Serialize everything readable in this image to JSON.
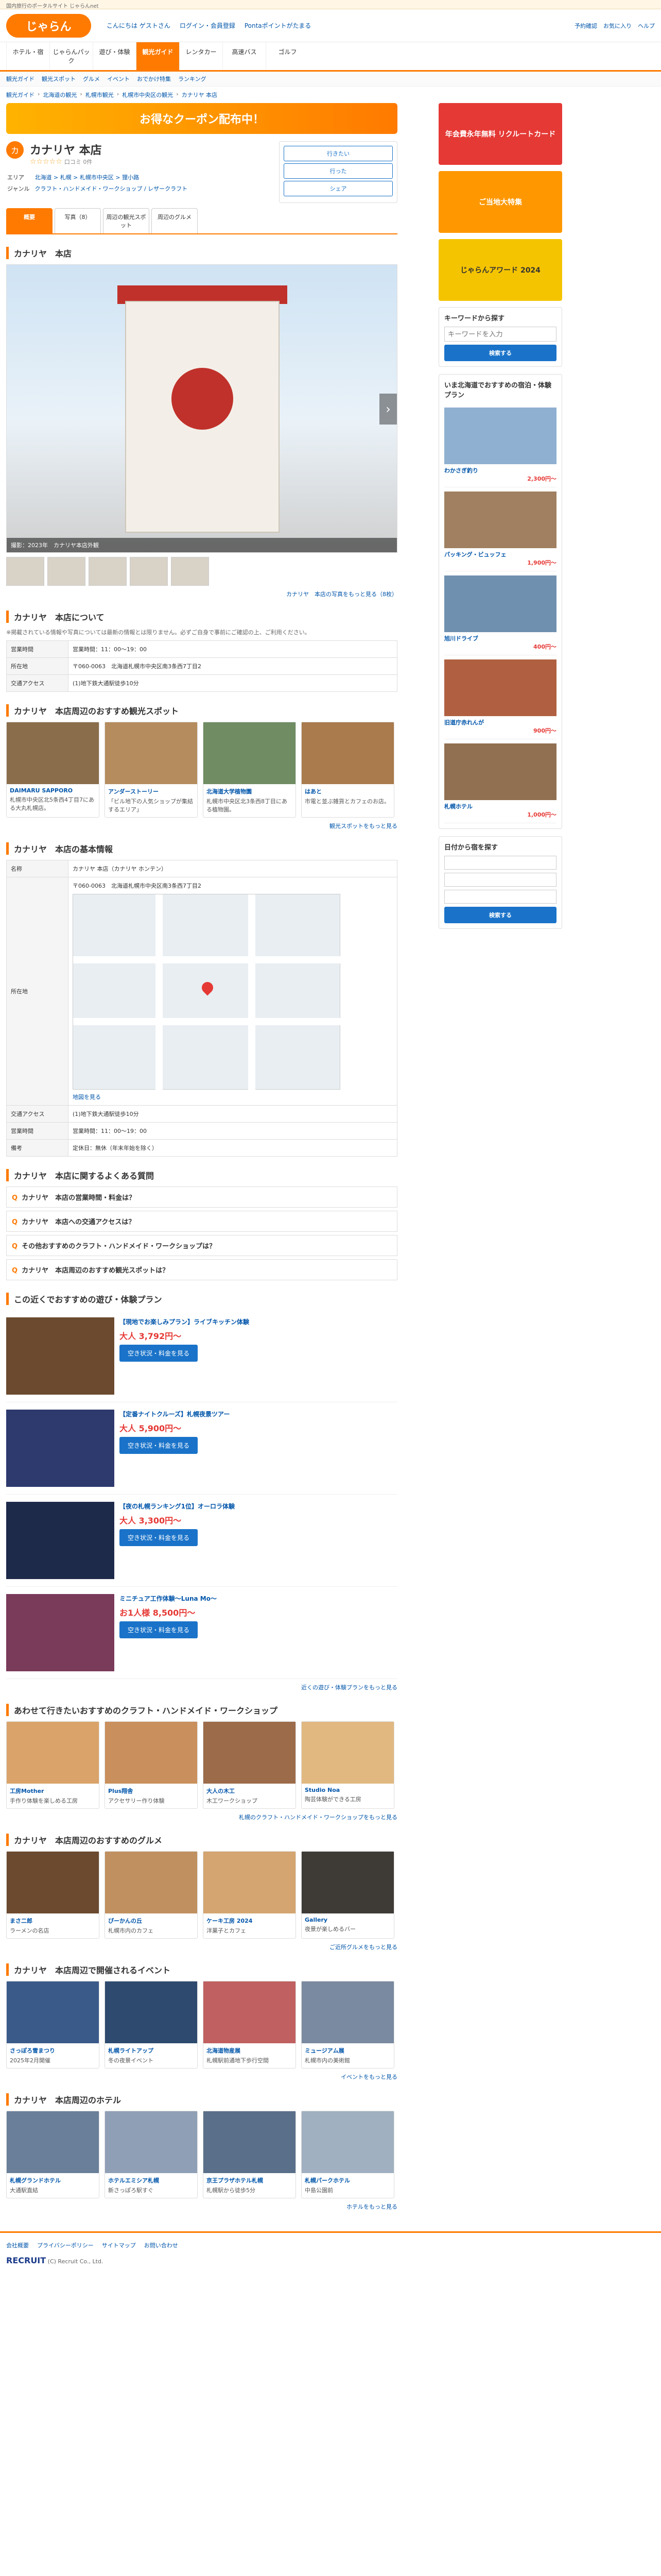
{
  "topbar": {
    "text": "国内旅行のポータルサイト じゃらんnet"
  },
  "header": {
    "logo": "じゃらん",
    "links": [
      "こんにちは ゲストさん",
      "ログイン・会員登録",
      "Pontaポイントがたまる"
    ],
    "right": [
      "予約確認",
      "お気に入り",
      "ヘルプ"
    ]
  },
  "nav": [
    {
      "label": "ホテル・宿",
      "active": false
    },
    {
      "label": "じゃらんパック",
      "active": false
    },
    {
      "label": "遊び・体験",
      "active": false
    },
    {
      "label": "観光ガイド",
      "active": true
    },
    {
      "label": "レンタカー",
      "active": false
    },
    {
      "label": "高速バス",
      "active": false
    },
    {
      "label": "ゴルフ",
      "active": false
    }
  ],
  "subnav": [
    "観光ガイド",
    "観光スポット",
    "グルメ",
    "イベント",
    "おでかけ特集",
    "ランキング"
  ],
  "breadcrumb": [
    "観光ガイド",
    "北海道の観光",
    "札幌市観光",
    "札幌市中央区の観光",
    "カナリヤ 本店"
  ],
  "banner": {
    "text": "お得なクーポン配布中！"
  },
  "spot": {
    "icon": "カ",
    "title": "カナリヤ 本店",
    "rating": "☆☆☆☆☆",
    "review_count": "口コミ 0件",
    "area_label": "エリア",
    "area": "北海道 > 札幌 > 札幌市中央区 > 狸小路",
    "genre_label": "ジャンル",
    "genre": "クラフト・ハンドメイド・ワークショップ / レザークラフト",
    "tabs": [
      {
        "label": "概要",
        "active": true
      },
      {
        "label": "写真（8）",
        "active": false
      },
      {
        "label": "周辺の観光スポット",
        "active": false
      },
      {
        "label": "周辺のグルメ",
        "active": false
      }
    ]
  },
  "actions": {
    "favorite": "行きたい",
    "went": "行った",
    "share": "シェア"
  },
  "photo": {
    "section_title": "カナリヤ　本店",
    "caption": "撮影：2023年　カナリヤ本店外観",
    "more": "カナリヤ　本店の写真をもっと見る（8枚）"
  },
  "about": {
    "title": "カナリヤ　本店について",
    "note": "※掲載されている情報や写真については最新の情報とは限りません。必ずご自身で事前にご確認の上、ご利用ください。",
    "rows": [
      {
        "label": "営業時間",
        "value": "営業時間：11：00～19：00"
      },
      {
        "label": "所在地",
        "value": "〒060-0063　北海道札幌市中央区南3条西7丁目2"
      },
      {
        "label": "交通アクセス",
        "value": "(1)地下鉄大通駅徒歩10分"
      }
    ]
  },
  "nearby_spots": {
    "title": "カナリヤ　本店周辺のおすすめ観光スポット",
    "items": [
      {
        "name": "DAIMARU SAPPORO",
        "desc": "札幌市中央区北5条西4丁目7にある大丸札幌店。"
      },
      {
        "name": "アンダーストーリー",
        "desc": "「ビル地下の人気ショップが集結するエリア」"
      },
      {
        "name": "北海道大学植物園",
        "desc": "札幌市中央区北3条西8丁目にある植物園。"
      },
      {
        "name": "はあと",
        "desc": "市電と並ぶ雑貨とカフェのお店。"
      }
    ],
    "more": "観光スポットをもっと見る"
  },
  "basic": {
    "title": "カナリヤ　本店の基本情報",
    "rows": [
      {
        "label": "名称",
        "value": "カナリヤ 本店（カナリヤ ホンテン）"
      },
      {
        "label": "所在地",
        "value": "〒060-0063　北海道札幌市中央区南3条西7丁目2"
      },
      {
        "label": "交通アクセス",
        "value": "(1)地下鉄大通駅徒歩10分"
      },
      {
        "label": "営業時間",
        "value": "営業時間：11：00～19：00"
      },
      {
        "label": "備考",
        "value": "定休日：無休（年末年始を除く）"
      }
    ],
    "map_label": "地図を見る"
  },
  "faq": {
    "title": "カナリヤ　本店に関するよくある質問",
    "items": [
      "カナリヤ　本店の営業時間・料金は？",
      "カナリヤ　本店への交通アクセスは？",
      "その他おすすめのクラフト・ハンドメイド・ワークショップは？",
      "カナリヤ　本店周辺のおすすめ観光スポットは？"
    ]
  },
  "plans": {
    "title": "この近くでおすすめの遊び・体験プラン",
    "items": [
      {
        "title": "【現地でお楽しみプラン】ライブキッチン体験",
        "price": "大人 3,792円〜",
        "btn": "空き状況・料金を見る"
      },
      {
        "title": "【定番ナイトクルーズ】札幌夜景ツアー",
        "price": "大人 5,900円〜",
        "btn": "空き状況・料金を見る"
      },
      {
        "title": "【夜の札幌ランキング1位】オーロラ体験",
        "price": "大人 3,300円〜",
        "btn": "空き状況・料金を見る"
      },
      {
        "title": "ミニチュア工作体験〜Luna Mo〜",
        "price": "お1人様 8,500円〜",
        "btn": "空き状況・料金を見る"
      }
    ],
    "more": "近くの遊び・体験プランをもっと見る"
  },
  "crafts": {
    "title": "あわせて行きたいおすすめのクラフト・ハンドメイド・ワークショップ",
    "items": [
      {
        "name": "工房Mother",
        "desc": "手作り体験を楽しめる工房"
      },
      {
        "name": "Plus翔舎",
        "desc": "アクセサリー作り体験"
      },
      {
        "name": "大人の木工",
        "desc": "木工ワークショップ"
      },
      {
        "name": "Studio Noa",
        "desc": "陶芸体験ができる工房"
      }
    ],
    "more": "札幌のクラフト・ハンドメイド・ワークショップをもっと見る"
  },
  "gourmet": {
    "title": "カナリヤ　本店周辺のおすすめのグルメ",
    "items": [
      {
        "name": "まさ二郎",
        "desc": "ラーメンの名店"
      },
      {
        "name": "ぴーかんの丘",
        "desc": "札幌市内のカフェ"
      },
      {
        "name": "ケーキ工房 2024",
        "desc": "洋菓子とカフェ"
      },
      {
        "name": "Gallery",
        "desc": "夜景が楽しめるバー"
      }
    ],
    "more": "ご近所グルメをもっと見る"
  },
  "events": {
    "title": "カナリヤ　本店周辺で開催されるイベント",
    "items": [
      {
        "name": "さっぽろ雪まつり",
        "desc": "2025年2月開催"
      },
      {
        "name": "札幌ライトアップ",
        "desc": "冬の夜景イベント"
      },
      {
        "name": "北海道物産展",
        "desc": "札幌駅前通地下歩行空間"
      },
      {
        "name": "ミュージアム展",
        "desc": "札幌市内の美術館"
      }
    ],
    "more": "イベントをもっと見る"
  },
  "hotels": {
    "title": "カナリヤ　本店周辺のホテル",
    "items": [
      {
        "name": "札幌グランドホテル",
        "desc": "大通駅直結"
      },
      {
        "name": "ホテルエミシア札幌",
        "desc": "新さっぽろ駅すぐ"
      },
      {
        "name": "京王プラザホテル札幌",
        "desc": "札幌駅から徒歩5分"
      },
      {
        "name": "札幌パークホテル",
        "desc": "中島公園前"
      }
    ],
    "more": "ホテルをもっと見る"
  },
  "sidebar": {
    "ads": [
      "年会費永年無料 リクルートカード",
      "ご当地大特集",
      "じゃらんアワード 2024"
    ],
    "search_title": "キーワードから探す",
    "search_placeholder": "キーワードを入力",
    "search_btn": "検索する",
    "hotels_title": "いま北海道でおすすめの宿泊・体験プラン",
    "hotels": [
      {
        "name": "わかさぎ釣り",
        "price": "2,300円〜"
      },
      {
        "name": "パッキング・ビュッフェ",
        "price": "1,900円〜"
      },
      {
        "name": "旭川ドライブ",
        "price": "400円〜"
      },
      {
        "name": "旧道庁赤れんが",
        "price": "900円〜"
      },
      {
        "name": "札幌ホテル",
        "price": "1,000円〜"
      }
    ],
    "date_title": "日付から宿を探す",
    "date_btn": "検索する"
  },
  "footer": {
    "links": [
      "会社概要",
      "プライバシーポリシー",
      "サイトマップ",
      "お問い合わせ"
    ],
    "brand": "RECRUIT",
    "copyright": "(C) Recruit Co., Ltd."
  }
}
